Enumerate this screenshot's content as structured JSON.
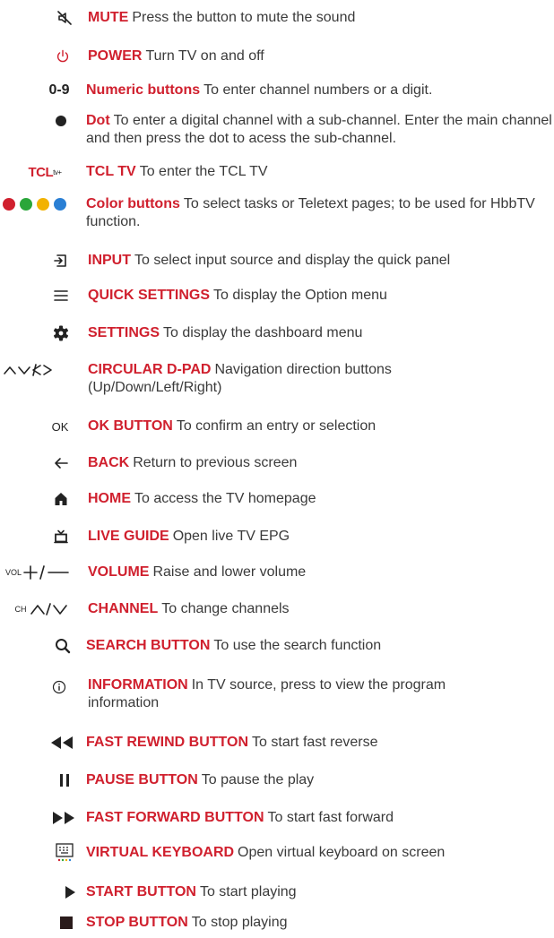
{
  "items": [
    {
      "label": "MUTE",
      "desc": "Press the button to mute the sound",
      "icon": "mute-icon"
    },
    {
      "label": "POWER",
      "desc": "Turn TV on and off",
      "icon": "power-icon"
    },
    {
      "label": "Numeric buttons",
      "desc": "To enter channel numbers or a digit.",
      "icon": "numeric-icon",
      "icon_text": "0-9"
    },
    {
      "label": "Dot",
      "desc": "To enter a digital channel with a sub-channel. Enter the main channel and then press the dot to acess the sub-channel.",
      "icon": "dot-icon"
    },
    {
      "label": "TCL TV",
      "desc": "To enter the TCL TV",
      "icon": "tcl-tv-logo",
      "icon_text": "TCL",
      "icon_sup": "tv+"
    },
    {
      "label": "Color buttons",
      "desc": "To select tasks or Teletext pages; to be used for HbbTV function.",
      "icon": "color-buttons-icon",
      "colors": [
        "#d0202e",
        "#2aa63a",
        "#f2b200",
        "#2a7fd4"
      ]
    },
    {
      "label": "INPUT",
      "desc": "To select input source and display the quick panel",
      "icon": "input-icon"
    },
    {
      "label": "QUICK SETTINGS",
      "desc": "To display the Option menu",
      "icon": "menu-icon"
    },
    {
      "label": "SETTINGS",
      "desc": "To display the dashboard menu",
      "icon": "gear-icon"
    },
    {
      "label": "CIRCULAR D-PAD",
      "desc": "Navigation direction buttons (Up/Down/Left/Right)",
      "icon": "dpad-arrows-icon"
    },
    {
      "label": "OK BUTTON",
      "desc": "To confirm an entry or selection",
      "icon": "ok-icon",
      "icon_text": "OK"
    },
    {
      "label": "BACK",
      "desc": "Return to previous screen",
      "icon": "back-arrow-icon"
    },
    {
      "label": "HOME",
      "desc": "To access the TV homepage",
      "icon": "home-icon"
    },
    {
      "label": "LIVE GUIDE",
      "desc": "Open live TV EPG",
      "icon": "tv-guide-icon"
    },
    {
      "label": "VOLUME",
      "desc": "Raise and lower volume",
      "icon": "volume-icon",
      "icon_text": "VOL"
    },
    {
      "label": "CHANNEL",
      "desc": "To change channels",
      "icon": "channel-icon",
      "icon_text": "CH"
    },
    {
      "label": "SEARCH BUTTON",
      "desc": "To use the search function",
      "icon": "search-icon"
    },
    {
      "label": "INFORMATION",
      "desc": "In TV source, press to view the program information",
      "icon": "info-icon"
    },
    {
      "label": "FAST REWIND BUTTON",
      "desc": "To start fast reverse",
      "icon": "rewind-icon"
    },
    {
      "label": "PAUSE BUTTON",
      "desc": "To pause the play",
      "icon": "pause-icon"
    },
    {
      "label": "FAST FORWARD BUTTON",
      "desc": "To start fast forward",
      "icon": "fast-forward-icon"
    },
    {
      "label": "VIRTUAL KEYBOARD",
      "desc": "Open virtual keyboard on screen",
      "icon": "keyboard-icon"
    },
    {
      "label": "START BUTTON",
      "desc": "To start playing",
      "icon": "play-icon"
    },
    {
      "label": "STOP BUTTON",
      "desc": "To stop playing",
      "icon": "stop-icon"
    }
  ],
  "colors": {
    "label": "#d0202e",
    "text": "#3a3a3a",
    "icon": "#222222"
  }
}
